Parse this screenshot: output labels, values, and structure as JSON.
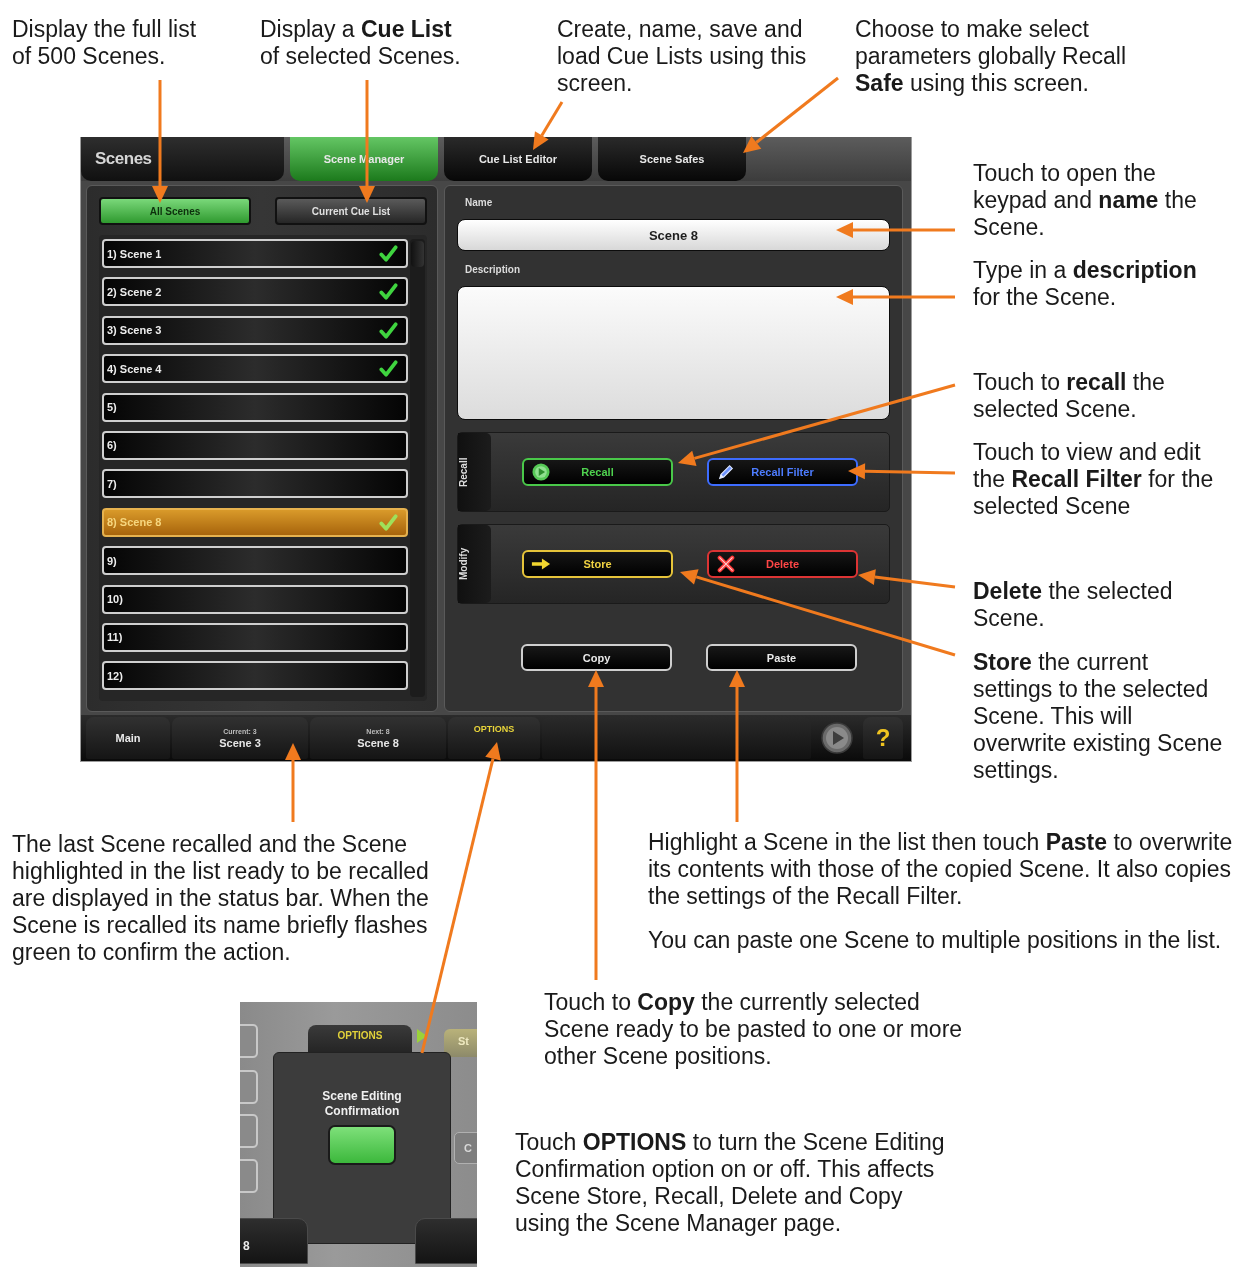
{
  "callouts": [
    {
      "paragraphs": [
        "Display the full list of 500 Scenes."
      ]
    },
    {
      "paragraphs": [
        "Display a **Cue List** of selected Scenes."
      ]
    },
    {
      "paragraphs": [
        "Create, name, save and load Cue Lists using this screen."
      ]
    },
    {
      "paragraphs": [
        "Choose to make select parameters globally Recall **Safe** using this screen."
      ]
    },
    {
      "paragraphs": [
        "Touch to open the keypad and **name** the Scene."
      ]
    },
    {
      "paragraphs": [
        "Type in a **description** for the Scene."
      ]
    },
    {
      "paragraphs": [
        "Touch to **recall** the selected Scene."
      ]
    },
    {
      "paragraphs": [
        "Touch to view and edit the **Recall Filter** for the selected Scene"
      ]
    },
    {
      "paragraphs": [
        "**Delete** the selected Scene."
      ]
    },
    {
      "paragraphs": [
        "**Store** the current settings to the selected Scene. This will overwrite existing Scene settings."
      ]
    },
    {
      "paragraphs": [
        "The last Scene recalled and the Scene highlighted in the list ready to be recalled are displayed in the status bar. When the Scene is recalled its name briefly flashes green to confirm the action."
      ]
    },
    {
      "paragraphs": [
        "Highlight a Scene in the list then touch **Paste** to overwrite its contents with those of the copied Scene. It also copies the settings of the Recall Filter.",
        "You can paste one Scene to multiple positions in the list."
      ]
    },
    {
      "paragraphs": [
        "Touch to **Copy** the currently selected Scene ready to be pasted to one or more other Scene positions."
      ]
    },
    {
      "paragraphs": [
        "Touch **OPTIONS** to turn the Scene Editing Confirmation option on or off. This affects Scene Store, Recall, Delete and Copy using the Scene Manager page."
      ]
    }
  ],
  "screen": {
    "title": "Scenes",
    "tabs": [
      {
        "label": "Scene Manager",
        "selected": true
      },
      {
        "label": "Cue List Editor",
        "selected": false
      },
      {
        "label": "Scene Safes",
        "selected": false
      }
    ],
    "list_filters": [
      {
        "label": "All Scenes",
        "selected": true
      },
      {
        "label": "Current Cue List",
        "selected": false
      }
    ],
    "scenes": [
      {
        "label": "1) Scene 1",
        "stored": true,
        "selected": false
      },
      {
        "label": "2) Scene 2",
        "stored": true,
        "selected": false
      },
      {
        "label": "3) Scene 3",
        "stored": true,
        "selected": false
      },
      {
        "label": "4) Scene 4",
        "stored": true,
        "selected": false
      },
      {
        "label": "5)",
        "stored": false,
        "selected": false
      },
      {
        "label": "6)",
        "stored": false,
        "selected": false
      },
      {
        "label": "7)",
        "stored": false,
        "selected": false
      },
      {
        "label": "8) Scene 8",
        "stored": true,
        "selected": true
      },
      {
        "label": "9)",
        "stored": false,
        "selected": false
      },
      {
        "label": "10)",
        "stored": false,
        "selected": false
      },
      {
        "label": "11)",
        "stored": false,
        "selected": false
      },
      {
        "label": "12)",
        "stored": false,
        "selected": false
      }
    ],
    "name_field": {
      "label": "Name",
      "value": "Scene 8"
    },
    "description_field": {
      "label": "Description"
    },
    "button_groups": [
      {
        "label": "Recall",
        "buttons": [
          {
            "label": "Recall",
            "kind": "recall"
          },
          {
            "label": "Recall Filter",
            "kind": "filter"
          }
        ]
      },
      {
        "label": "Modify",
        "buttons": [
          {
            "label": "Store",
            "kind": "store"
          },
          {
            "label": "Delete",
            "kind": "delete"
          }
        ]
      }
    ],
    "clipboard_buttons": [
      {
        "label": "Copy"
      },
      {
        "label": "Paste"
      }
    ],
    "status_bar": {
      "home": "Main",
      "current": {
        "caption": "Current: 3",
        "value": "Scene 3"
      },
      "next": {
        "caption": "Next: 8",
        "value": "Scene 8"
      },
      "options": "OPTIONS",
      "help": "?"
    }
  },
  "options_inset": {
    "tab": "OPTIONS",
    "side_tab_fragment": "St",
    "title": "Scene Editing Confirmation",
    "toggle": {
      "on": true
    },
    "side_button_fragment": "C",
    "status_fragment": "8"
  }
}
